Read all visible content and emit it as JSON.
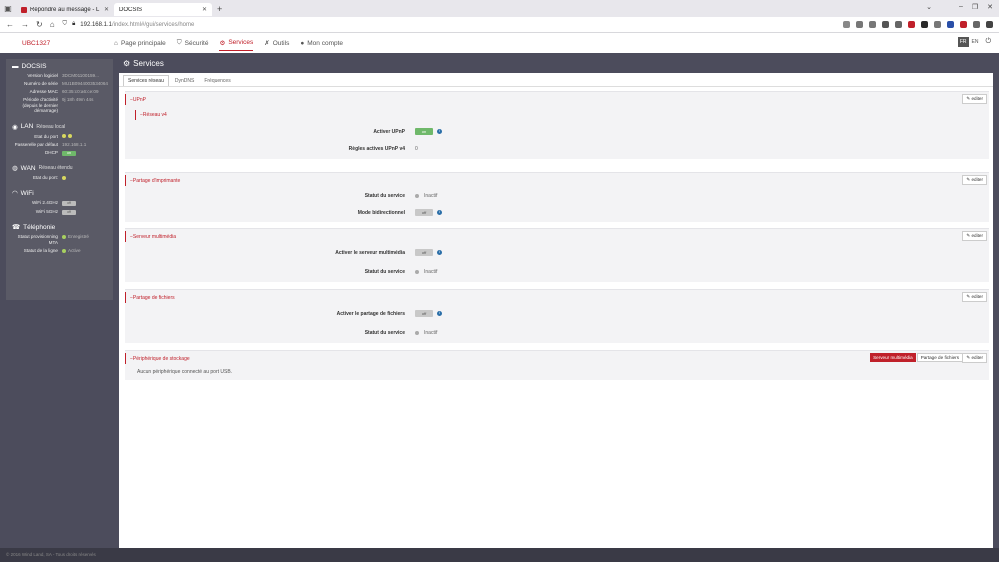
{
  "browser": {
    "tabs": [
      {
        "label": "Répondre au message - L",
        "active": false
      },
      {
        "label": "DOCSIS",
        "active": true
      }
    ],
    "url_host": "192.168.1.1",
    "url_path": "/index.html#/gui/services/home"
  },
  "header": {
    "device": "UBC1327",
    "nav": [
      "Page principale",
      "Sécurité",
      "Services",
      "Outils",
      "Mon compte"
    ],
    "active_nav": "Services",
    "lang_fr": "FR",
    "lang_en": "EN"
  },
  "sidebar": {
    "docsis": {
      "title": "DOCSIS",
      "rows": [
        {
          "k": "Version logiciel",
          "v": "3DCM01100159..."
        },
        {
          "k": "Numéro de série",
          "v": "MU1B0944003534064"
        },
        {
          "k": "Adresse MAC",
          "v": "60:35:c0:a6:ce:09"
        },
        {
          "k": "Période d'activité (depuis le dernier démarrage)",
          "v": "9j 18h 49m 44s"
        }
      ]
    },
    "lan": {
      "title": "LAN",
      "sub": "Réseau local",
      "port_label": "Etat du port",
      "gw_label": "Passerelle par défaut",
      "gw_value": "192.168.1.1",
      "dhcp_label": "DHCP",
      "dhcp_value": "on"
    },
    "wan": {
      "title": "WAN",
      "sub": "Réseau étendu",
      "port_label": "Etat du port:"
    },
    "wifi": {
      "title": "WiFi",
      "w24_label": "WiFi 2.4GHz",
      "w24_value": "off",
      "w5_label": "WiFi 5GHz",
      "w5_value": "off"
    },
    "tel": {
      "title": "Téléphonie",
      "mta_label": "Statut provisionning MTA",
      "mta_value": "Enregistré",
      "line_label": "Statut de la ligne",
      "line_value": "Active"
    }
  },
  "content": {
    "title": "Services",
    "subtabs": [
      "Services réseau",
      "DynDNS",
      "Fréquences"
    ],
    "edit_label": "editer",
    "upnp": {
      "head": "UPnP",
      "sub": "Réseau v4",
      "enable_label": "Activer UPnP",
      "enable_value": "on",
      "rules_label": "Règles actives UPnP v4",
      "rules_value": "0"
    },
    "printer": {
      "head": "Partage d'imprimante",
      "status_label": "Statut du service",
      "status_value": "Inactif",
      "bidir_label": "Mode bidirectionnel",
      "bidir_value": "off"
    },
    "media": {
      "head": "Serveur multimédia",
      "enable_label": "Activer le serveur multimédia",
      "enable_value": "off",
      "status_label": "Statut du service",
      "status_value": "Inactif"
    },
    "files": {
      "head": "Partage de fichiers",
      "enable_label": "Activer le partage de fichiers",
      "enable_value": "off",
      "status_label": "Statut du service",
      "status_value": "Inactif"
    },
    "storage": {
      "head": "Périphérique de stockage",
      "btn_media": "Serveur multimédia",
      "btn_files": "Partage de fichiers",
      "message": "Aucun périphérique connecté au port USB."
    }
  },
  "footer": {
    "text": "© 2016 Wind Land, SA - Tous droits réservés"
  },
  "colors": {
    "accent": "#c0202a",
    "sidebar": "#5a5a66",
    "switch_on": "#6fb86a"
  }
}
